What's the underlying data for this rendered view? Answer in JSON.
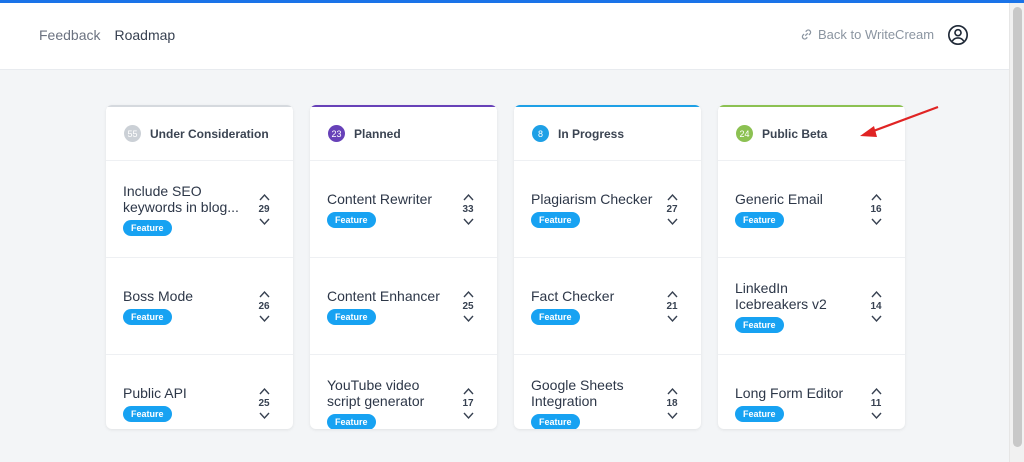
{
  "header": {
    "nav": [
      {
        "label": "Feedback"
      },
      {
        "label": "Roadmap"
      }
    ],
    "back_label": "Back to WriteCream"
  },
  "columns": [
    {
      "title": "Under Consideration",
      "count": "55",
      "color": "#cbd0d6",
      "cards": [
        {
          "title": "Include SEO keywords in blog...",
          "tag": "Feature",
          "votes": "29"
        },
        {
          "title": "Boss Mode",
          "tag": "Feature",
          "votes": "26"
        },
        {
          "title": "Public API",
          "tag": "Feature",
          "votes": "25"
        }
      ]
    },
    {
      "title": "Planned",
      "count": "23",
      "color": "#6741b8",
      "cards": [
        {
          "title": "Content Rewriter",
          "tag": "Feature",
          "votes": "33"
        },
        {
          "title": "Content Enhancer",
          "tag": "Feature",
          "votes": "25"
        },
        {
          "title": "YouTube video script generator",
          "tag": "Feature",
          "votes": "17"
        }
      ]
    },
    {
      "title": "In Progress",
      "count": "8",
      "color": "#1ea0e6",
      "cards": [
        {
          "title": "Plagiarism Checker",
          "tag": "Feature",
          "votes": "27"
        },
        {
          "title": "Fact Checker",
          "tag": "Feature",
          "votes": "21"
        },
        {
          "title": "Google Sheets Integration",
          "tag": "Feature",
          "votes": "18"
        }
      ]
    },
    {
      "title": "Public Beta",
      "count": "24",
      "color": "#8cc152",
      "cards": [
        {
          "title": "Generic Email",
          "tag": "Feature",
          "votes": "16"
        },
        {
          "title": "LinkedIn Icebreakers v2",
          "tag": "Feature",
          "votes": "14"
        },
        {
          "title": "Long Form Editor",
          "tag": "Feature",
          "votes": "11"
        }
      ]
    }
  ],
  "colors": {
    "accent": "#1a73e8",
    "tag": "#17a2f2",
    "annotation": "#e02424"
  }
}
